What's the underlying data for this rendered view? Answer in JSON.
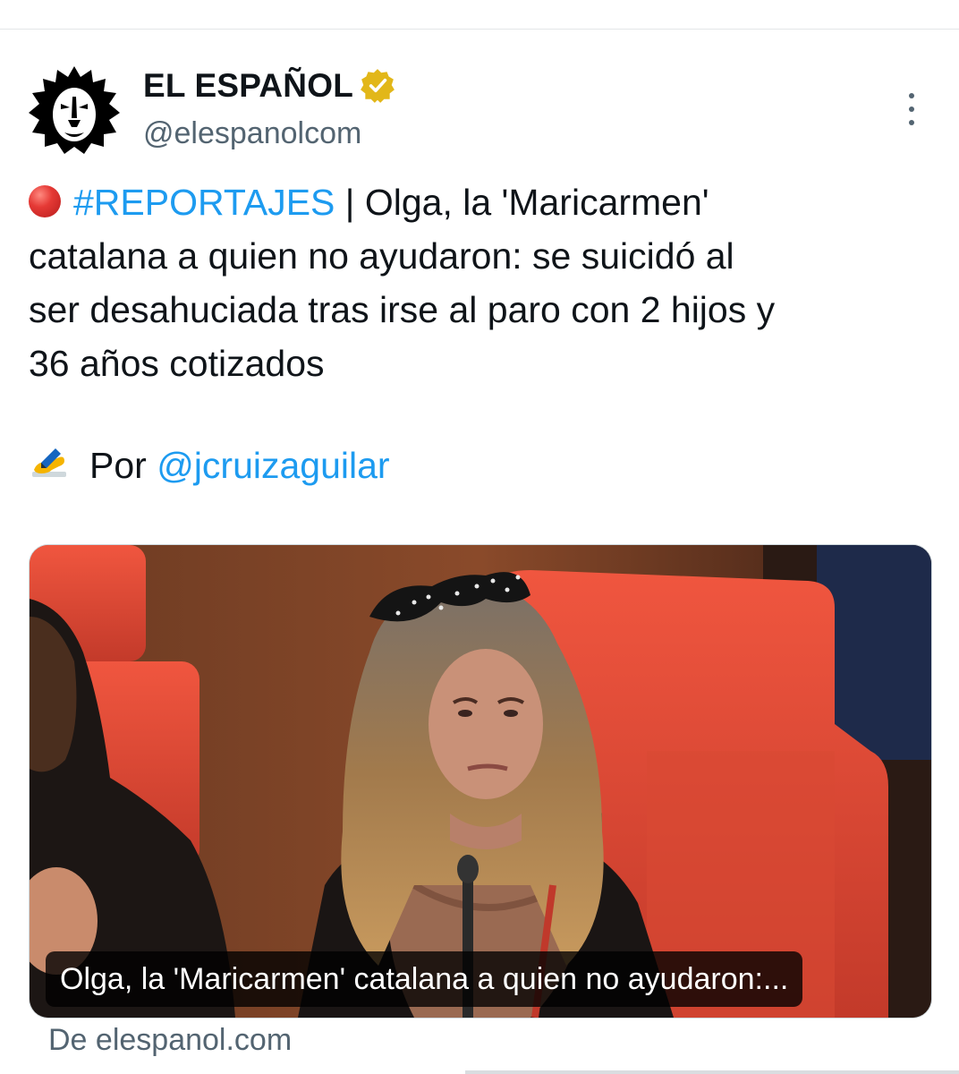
{
  "account": {
    "display_name": "EL ESPAÑOL",
    "handle": "@elespanolcom",
    "avatar_icon": "lion-head-icon",
    "verified_icon": "verified-badge-icon",
    "verified_color": "#e2b719"
  },
  "menu": {
    "icon": "more-vertical-icon"
  },
  "tweet": {
    "hashtag": "#REPORTAJES",
    "line1_rest": " | Olga, la 'Maricarmen'",
    "line2": "catalana a quien no ayudaron: se suicidó al",
    "line3": "ser desahuciada tras irse al paro con 2 hijos y",
    "line4": "36 años cotizados",
    "by_prefix": "Por ",
    "author_mention": "@jcruizaguilar",
    "icons": [
      "red-circle-icon",
      "writing-hand-icon"
    ]
  },
  "card": {
    "caption": "Olga, la 'Maricarmen' catalana a quien no ayudaron:...",
    "source": "De elespanol.com"
  },
  "colors": {
    "link": "#1d9bf0",
    "text": "#0f1419",
    "secondary": "#536471",
    "border": "#cfd9de"
  }
}
